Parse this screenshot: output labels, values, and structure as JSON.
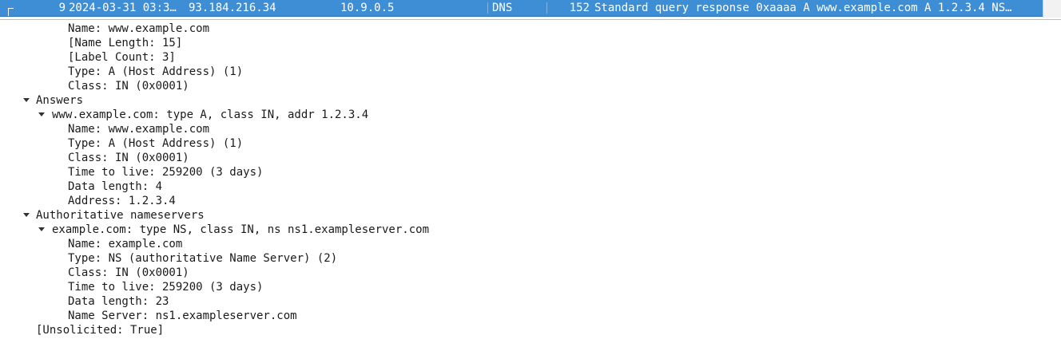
{
  "packet_list": {
    "selected_row": {
      "no": "9",
      "time": "2024-03-31 03:3…",
      "source": "93.184.216.34",
      "destination": "10.9.0.5",
      "protocol": "DNS",
      "length": "152",
      "info": "Standard query response 0xaaaa A www.example.com A 1.2.3.4 NS…"
    }
  },
  "details": {
    "query_fields": [
      "Name: www.example.com",
      "[Name Length: 15]",
      "[Label Count: 3]",
      "Type: A (Host Address) (1)",
      "Class: IN (0x0001)"
    ],
    "answers": {
      "label": "Answers",
      "record": {
        "label": "www.example.com: type A, class IN, addr 1.2.3.4",
        "fields": [
          "Name: www.example.com",
          "Type: A (Host Address) (1)",
          "Class: IN (0x0001)",
          "Time to live: 259200 (3 days)",
          "Data length: 4",
          "Address: 1.2.3.4"
        ]
      }
    },
    "authority": {
      "label": "Authoritative nameservers",
      "record": {
        "label": "example.com: type NS, class IN, ns ns1.exampleserver.com",
        "fields": [
          "Name: example.com",
          "Type: NS (authoritative Name Server) (2)",
          "Class: IN (0x0001)",
          "Time to live: 259200 (3 days)",
          "Data length: 23",
          "Name Server: ns1.exampleserver.com"
        ]
      }
    },
    "unsolicited": "[Unsolicited: True]"
  },
  "colors": {
    "selection": "#3d8ed4",
    "selection_text": "#ffffff",
    "text": "#1a1a1a"
  },
  "icons": {
    "expanded": "triangle-down-icon",
    "frame_marker": "frame-bracket-icon"
  }
}
